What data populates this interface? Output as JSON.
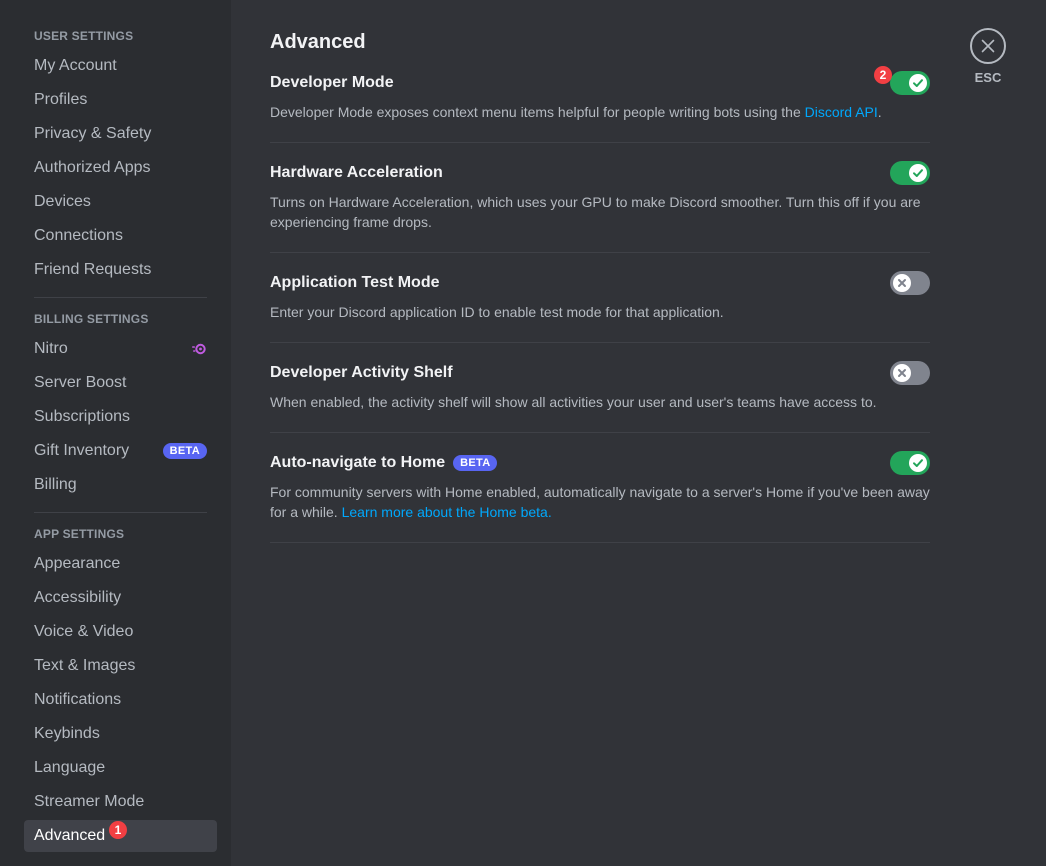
{
  "sidebar": {
    "sections": [
      {
        "header": "User Settings",
        "items": [
          {
            "label": "My Account"
          },
          {
            "label": "Profiles"
          },
          {
            "label": "Privacy & Safety"
          },
          {
            "label": "Authorized Apps"
          },
          {
            "label": "Devices"
          },
          {
            "label": "Connections"
          },
          {
            "label": "Friend Requests"
          }
        ]
      },
      {
        "header": "Billing Settings",
        "items": [
          {
            "label": "Nitro",
            "icon": "nitro-icon"
          },
          {
            "label": "Server Boost"
          },
          {
            "label": "Subscriptions"
          },
          {
            "label": "Gift Inventory",
            "badge": "BETA"
          },
          {
            "label": "Billing"
          }
        ]
      },
      {
        "header": "App Settings",
        "items": [
          {
            "label": "Appearance"
          },
          {
            "label": "Accessibility"
          },
          {
            "label": "Voice & Video"
          },
          {
            "label": "Text & Images"
          },
          {
            "label": "Notifications"
          },
          {
            "label": "Keybinds"
          },
          {
            "label": "Language"
          },
          {
            "label": "Streamer Mode"
          },
          {
            "label": "Advanced",
            "selected": true
          }
        ]
      }
    ]
  },
  "annotations": {
    "sidebar_marker": "1",
    "toggle_marker": "2"
  },
  "page": {
    "title": "Advanced",
    "settings": [
      {
        "title": "Developer Mode",
        "description": "Developer Mode exposes context menu items helpful for people writing bots using the ",
        "link": "Discord API",
        "description_end": ".",
        "enabled": true
      },
      {
        "title": "Hardware Acceleration",
        "description": "Turns on Hardware Acceleration, which uses your GPU to make Discord smoother. Turn this off if you are experiencing frame drops.",
        "enabled": true
      },
      {
        "title": "Application Test Mode",
        "description": "Enter your Discord application ID to enable test mode for that application.",
        "enabled": false
      },
      {
        "title": "Developer Activity Shelf",
        "description": "When enabled, the activity shelf will show all activities your user and user's teams have access to.",
        "enabled": false
      },
      {
        "title": "Auto-navigate to Home",
        "title_badge": "BETA",
        "description": "For community servers with Home enabled, automatically navigate to a server's Home if you've been away for a while. ",
        "link": "Learn more about the Home beta.",
        "enabled": true
      }
    ]
  },
  "close": {
    "label": "ESC"
  },
  "colors": {
    "background": "#313338",
    "sidebar": "#2b2d31",
    "toggle_on": "#23a55a",
    "toggle_off": "#80848e",
    "link": "#00a8fc",
    "beta": "#5865f2",
    "marker": "#f23f43",
    "nitro": "#c05be0"
  }
}
